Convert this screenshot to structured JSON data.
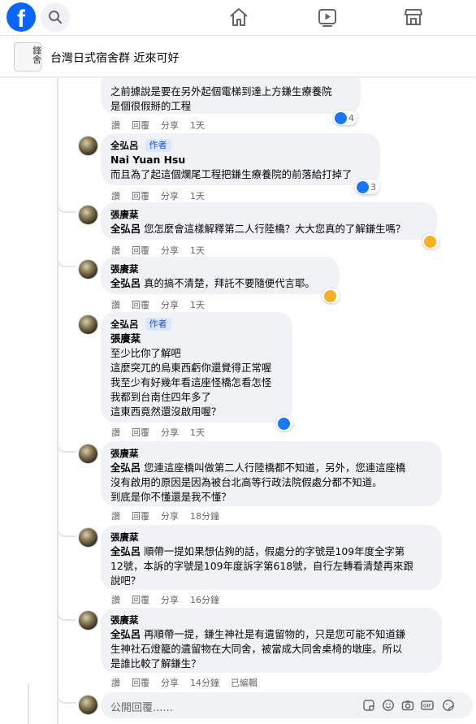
{
  "topbar": {
    "logo": "f",
    "icons": [
      "search-icon",
      "home-icon",
      "video-icon",
      "marketplace-icon"
    ]
  },
  "group": {
    "thumb_text": "鋒\n舍",
    "title": "台灣日式宿舍群 近來可好"
  },
  "comments": [
    {
      "author": "",
      "lines": [
        "之前據說是要在另外起個電梯到達上方鎌生療養院",
        "是個很假掰的工程"
      ],
      "reaction": {
        "type": "like",
        "count": "4"
      },
      "actions": [
        "讚",
        "回覆",
        "分享",
        "1天"
      ]
    },
    {
      "author": "全弘呂",
      "badge": "作者",
      "mention_line": "Nai Yuan Hsu",
      "lines": [
        "而且為了起這個爛尾工程把鎌生療養院的前落給打掉了"
      ],
      "reaction": {
        "type": "like",
        "count": "3"
      },
      "actions": [
        "讚",
        "回覆",
        "分享",
        "1天"
      ]
    },
    {
      "author": "張賡棻",
      "mention": "全弘呂",
      "lines": [
        " 您怎麼會這樣解釋第二人行陸橋？大大您真的了解鎌生嗎？"
      ],
      "reaction": {
        "type": "wow",
        "count": ""
      },
      "actions": [
        "讚",
        "回覆",
        "分享",
        "1天"
      ]
    },
    {
      "author": "張賡棻",
      "mention": "全弘呂",
      "lines": [
        " 真的搞不清楚，拜託不要隨便代言耶。"
      ],
      "reaction": {
        "type": "wow",
        "count": ""
      },
      "actions": [
        "讚",
        "回覆",
        "分享",
        "1天"
      ]
    },
    {
      "author": "全弘呂",
      "badge": "作者",
      "mention_line": "張賡棻",
      "lines": [
        "至少比你了解吧",
        "這麼突兀的鳥東西虧你還覺得正常喔",
        "我至少有好幾年看這座怪橋怎看怎怪",
        "我都到台南住四年多了",
        "這東西竟然還沒啟用喔？"
      ],
      "reaction": {
        "type": "like",
        "count": ""
      },
      "actions": [
        "讚",
        "回覆",
        "分享",
        "1天"
      ]
    },
    {
      "author": "張賡棻",
      "mention": "全弘呂",
      "lines": [
        " 您連這座橋叫做第二人行陸橋都不知道，另外，您連這座橋",
        "沒有啟用的原因是因為被台北高等行政法院假處分都不知道。",
        "到底是你不懂還是我不懂？"
      ],
      "actions": [
        "讚",
        "回覆",
        "分享",
        "18分鐘"
      ]
    },
    {
      "author": "張賡棻",
      "mention": "全弘呂",
      "lines": [
        " 順帶一提如果想佔夠的話，假處分的字號是109年度全字第",
        "12號，本訴的字號是109年度訴字第618號，自行左轉看清楚再來跟",
        "說吧？"
      ],
      "actions": [
        "讚",
        "回覆",
        "分享",
        "16分鐘"
      ]
    },
    {
      "author": "張賡棻",
      "mention": "全弘呂",
      "lines": [
        " 再順帶一提，鎌生神社是有遺留物的，只是您可能不知道鎌",
        "生神社石燈籠的遺留物在大同舍，被當成大同舍桌椅的墩座。所以",
        "是誰比較了解鎌生？"
      ],
      "actions": [
        "讚",
        "回覆",
        "分享",
        "14分鐘",
        "已編輯"
      ]
    }
  ],
  "reply": {
    "placeholder": "公開回覆......",
    "icons": [
      "sticker-icon",
      "emoji-icon",
      "camera-icon",
      "gif-icon",
      "sticker2-icon"
    ]
  }
}
